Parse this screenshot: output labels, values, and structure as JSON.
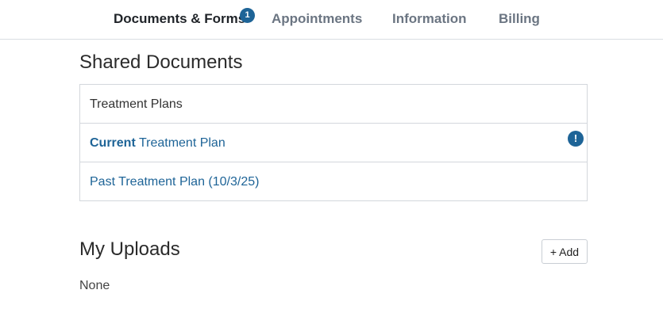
{
  "nav": {
    "tabs": [
      {
        "label": "Documents & Forms",
        "active": true,
        "badge": "1"
      },
      {
        "label": "Appointments",
        "active": false
      },
      {
        "label": "Information",
        "active": false
      },
      {
        "label": "Billing",
        "active": false
      }
    ]
  },
  "shared_documents": {
    "title": "Shared Documents",
    "header": "Treatment Plans",
    "items": [
      {
        "bold_prefix": "Current",
        "label": " Treatment Plan",
        "alert_icon": "exclamation-icon",
        "alert_glyph": "!"
      },
      {
        "label": "Past Treatment Plan (10/3/25)"
      }
    ]
  },
  "my_uploads": {
    "title": "My Uploads",
    "add_label": "+ Add",
    "empty_text": "None"
  },
  "colors": {
    "accent": "#1e6497",
    "active_tab": "#1f2328",
    "inactive_tab": "#6b7582",
    "border": "#d3d7dc"
  }
}
